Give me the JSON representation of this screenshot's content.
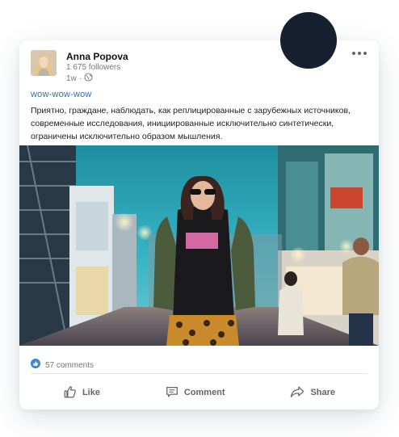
{
  "post": {
    "author_name": "Anna Popova",
    "followers": "1 675 followers",
    "posted_ago": "1w",
    "meta_separator": "·",
    "hashtag": "wow-wow-wow",
    "body": "Приятно, граждане, наблюдать, как реплицированные с зарубежных источников, современные исследования, инициированные исключительно синтетически, ограничены исключительно образом мышления.",
    "comments_count": "57 comments"
  },
  "actions": {
    "like": "Like",
    "comment": "Comment",
    "share": "Share"
  },
  "icons": {
    "more": "more-horizontal-icon",
    "visibility": "globe-icon",
    "reaction": "thumbs-up-icon",
    "like": "thumbs-up-outline-icon",
    "comment": "comment-icon",
    "share": "share-arrow-icon"
  },
  "colors": {
    "accent": "#2e6fb5",
    "like_badge": "#3b86d6",
    "dark_circle": "#16202f"
  }
}
